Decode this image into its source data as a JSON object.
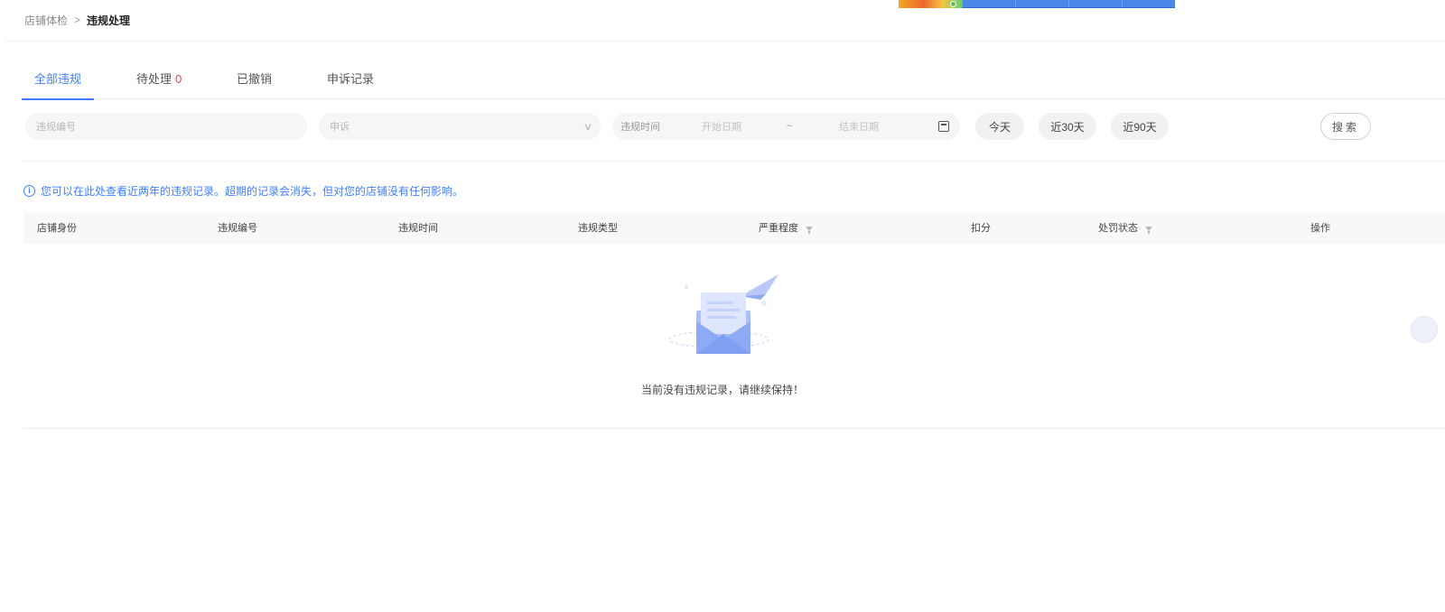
{
  "breadcrumb": {
    "parent": "店铺体检",
    "separator": ">",
    "current": "违规处理"
  },
  "tabs": [
    {
      "label": "全部违规",
      "active": true
    },
    {
      "label": "待处理",
      "count": "0"
    },
    {
      "label": "已撤销"
    },
    {
      "label": "申诉记录"
    }
  ],
  "filters": {
    "violation_no_placeholder": "违规编号",
    "appeal_select_value": "申诉",
    "date_label": "违规时间",
    "start_placeholder": "开始日期",
    "range_separator": "~",
    "end_placeholder": "结束日期",
    "quick_ranges": [
      "今天",
      "近30天",
      "近90天"
    ],
    "search_label": "搜索"
  },
  "notice": "您可以在此处查看近两年的违规记录。超期的记录会消失，但对您的店铺没有任何影响。",
  "table": {
    "columns": [
      "店铺身份",
      "违规编号",
      "违规时间",
      "违规类型",
      "严重程度",
      "扣分",
      "处罚状态",
      "操作"
    ]
  },
  "empty_state": {
    "message": "当前没有违规记录，请继续保持！"
  },
  "colors": {
    "accent": "#3f7fff",
    "danger": "#ff3b3b"
  }
}
